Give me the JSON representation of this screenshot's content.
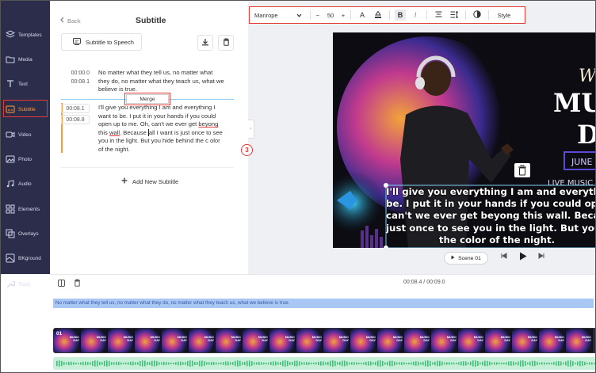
{
  "nav": {
    "items": [
      {
        "label": "Templates",
        "icon": "layers-icon"
      },
      {
        "label": "Media",
        "icon": "folder-icon"
      },
      {
        "label": "Text",
        "icon": "text-icon"
      },
      {
        "label": "Subtitle",
        "icon": "subtitle-icon",
        "active": true
      },
      {
        "label": "Video",
        "icon": "video-icon"
      },
      {
        "label": "Photo",
        "icon": "photo-icon"
      },
      {
        "label": "Audio",
        "icon": "music-icon"
      },
      {
        "label": "Elements",
        "icon": "elements-icon"
      },
      {
        "label": "Overlays",
        "icon": "overlays-icon"
      },
      {
        "label": "BKground",
        "icon": "background-icon"
      },
      {
        "label": "Tools",
        "icon": "tools-icon"
      }
    ]
  },
  "panel": {
    "back_label": "Back",
    "title": "Subtitle",
    "stt_label": "Subtitle to Speech",
    "merge_label": "Merge",
    "add_label": "Add New Subtitle",
    "entries": [
      {
        "start": "00:00.0",
        "end": "00:08.1",
        "text": "No matter what they tell us, no matter what they do, no matter what they teach us, what we believe is true."
      },
      {
        "start": "00:08.1",
        "end": "00:08.8",
        "text_parts": [
          "I'll give you everything I am and everything I want to be. I put it in your hands if you could open up to me. Oh, can't we ever get ",
          "beyong",
          " this ",
          "wall",
          ". Because ",
          "all",
          " I want is just once to see you in the light. But you hide behind the c olor of the night."
        ]
      }
    ],
    "step_badge": "3"
  },
  "toolbar": {
    "font": "Manrope",
    "size": "50",
    "style_label": "Style"
  },
  "preview": {
    "title_1": "W",
    "title_2": "MU",
    "title_3": "D",
    "date_box": "JUNE",
    "live": "LIVE MUSIC",
    "subtitle_lines": [
      "I'll give you everything I am and everythin",
      "be. I put it in your hands if you could open u",
      "can't we ever get beyong this wall. Becaus",
      "just once to see you in the light. But you h",
      "the color of the night."
    ],
    "scene_label": "Scene 01"
  },
  "timeline": {
    "time": "00:08.4 / 00:09.0",
    "subtitle_text": "No matter what they tell us, no matter what they do, no matter what they teach us, what we believe is true.",
    "clip_number": "01",
    "thumb_title": "MUSIC DAY"
  },
  "colors": {
    "nav_bg": "#2b2d4a",
    "accent": "#ff9a3c",
    "highlight_red": "#e53935",
    "date_box": "#5a4bd6"
  }
}
